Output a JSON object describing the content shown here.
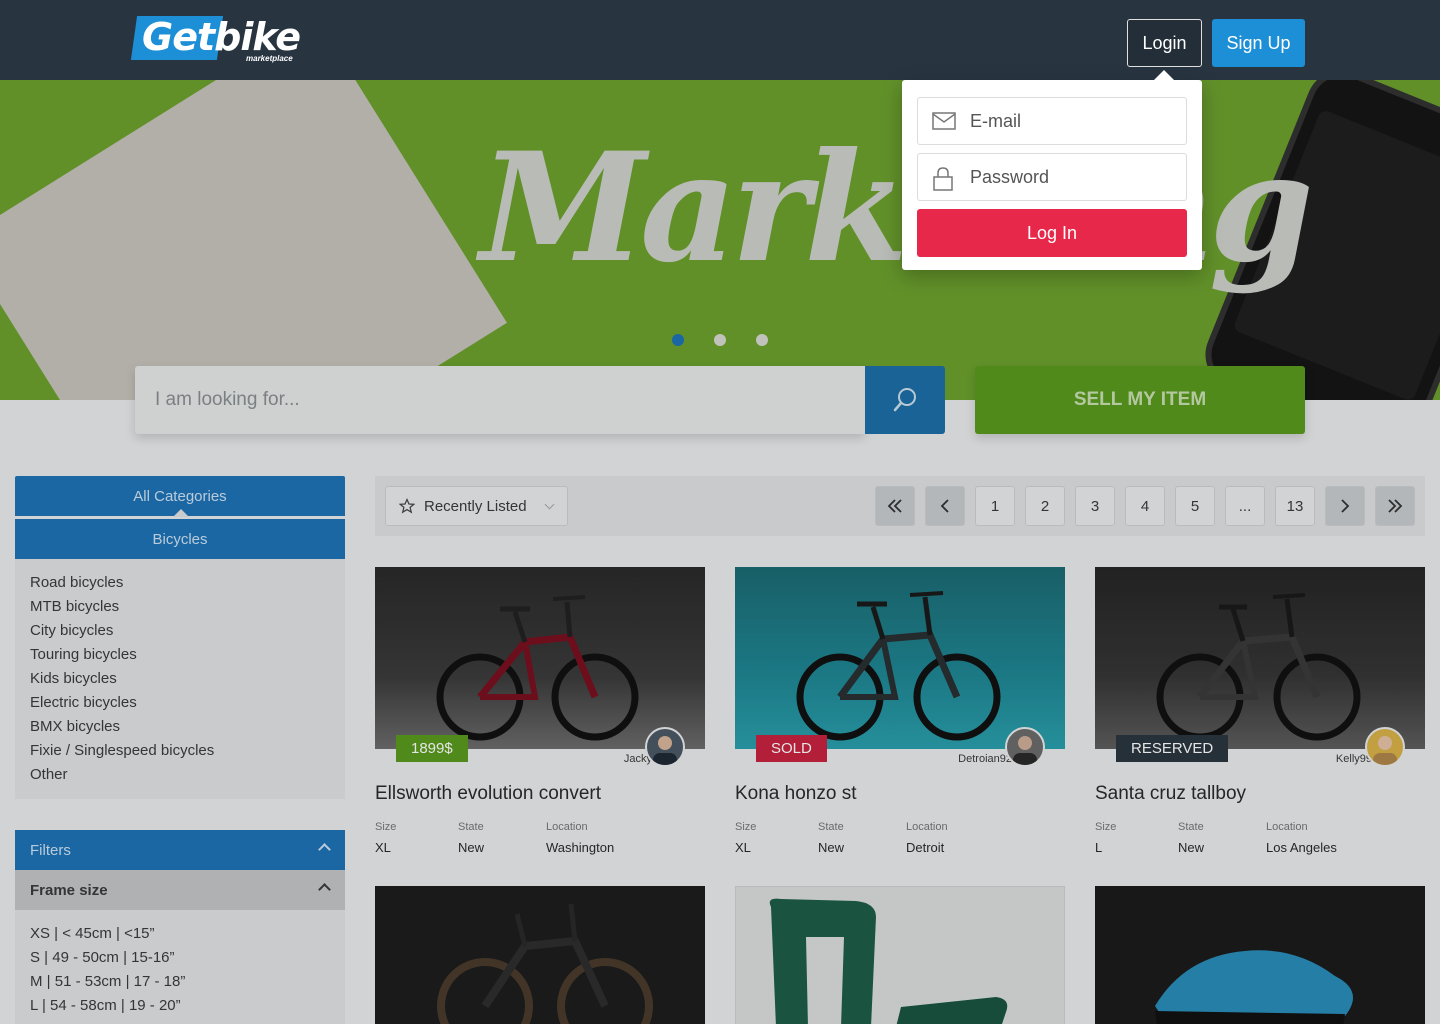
{
  "header": {
    "logo": "Getbike",
    "logo_sub": "marketplace",
    "login_label": "Login",
    "signup_label": "Sign Up"
  },
  "hero": {
    "banner_text": "Marketing",
    "slides": 3,
    "active_slide": 1
  },
  "search": {
    "placeholder": "I am looking for...",
    "sell_label": "SELL MY ITEM"
  },
  "sidebar": {
    "all_categories": "All Categories",
    "current_category": "Bicycles",
    "categories": [
      "Road bicycles",
      "MTB bicycles",
      "City bicycles",
      "Touring bicycles",
      "Kids bicycles",
      "Electric bicycles",
      "BMX bicycles",
      "Fixie / Singlespeed bicycles",
      "Other"
    ],
    "filters_label": "Filters",
    "frame_size_label": "Frame size",
    "frame_sizes": [
      "XS | < 45cm | <15”",
      "S | 49 - 50cm | 15-16”",
      "M | 51 - 53cm | 17 - 18”",
      "L | 54 - 58cm | 19 - 20”"
    ]
  },
  "toolbar": {
    "sort_label": "Recently Listed",
    "pages": [
      "1",
      "2",
      "3",
      "4",
      "5",
      "...",
      "13"
    ],
    "first_icon": "double-chevron-left-icon",
    "prev_icon": "chevron-left-icon",
    "next_icon": "chevron-right-icon",
    "last_icon": "double-chevron-right-icon"
  },
  "spec_labels": {
    "size": "Size",
    "state": "State",
    "location": "Location"
  },
  "listings": [
    {
      "title": "Ellsworth evolution convert",
      "tag": "1899$",
      "tag_color": "#5a9a1f",
      "user": "Jacky",
      "size": "XL",
      "state": "New",
      "location": "Washington"
    },
    {
      "title": "Kona honzo st",
      "tag": "SOLD",
      "tag_color": "#c8223f",
      "user": "Detroian92",
      "size": "XL",
      "state": "New",
      "location": "Detroit"
    },
    {
      "title": "Santa cruz tallboy",
      "tag": "RESERVED",
      "tag_color": "#2b3640",
      "user": "Kelly99",
      "size": "L",
      "state": "New",
      "location": "Los Angeles"
    }
  ],
  "login_dropdown": {
    "email_placeholder": "E-mail",
    "password_placeholder": "Password",
    "submit_label": "Log In"
  },
  "colors": {
    "header_bg": "#283541",
    "primary_blue": "#1d8fd6",
    "category_blue": "#1d73b6",
    "sell_green": "#5a9a1f",
    "login_red": "#e8284a"
  }
}
